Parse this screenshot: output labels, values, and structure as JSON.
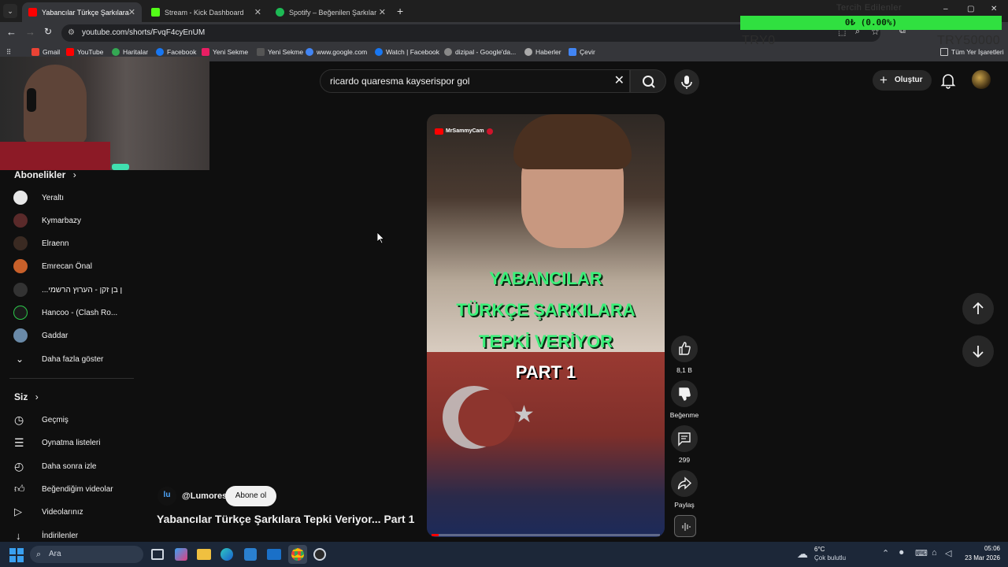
{
  "tabs": [
    {
      "label": "Yabancılar Türkçe Şarkılara Tepki",
      "color": "#ff0000"
    },
    {
      "label": "Stream - Kick Dashboard",
      "color": "#53fc18"
    },
    {
      "label": "Spotify – Beğenilen Şarkılar",
      "color": "#1db954"
    }
  ],
  "address": "youtube.com/shorts/FvqF4cyEnUM",
  "bookmarks": [
    "Gmail",
    "YouTube",
    "Haritalar",
    "Facebook",
    "Yeni Sekme",
    "Yeni Sekme",
    "www.google.com",
    "Watch | Facebook",
    "dizipal - Google'da...",
    "Haberler",
    "Çevir",
    "Tüm Yer İşaretleri"
  ],
  "search": {
    "query": "ricardo quaresma kayserispor gol"
  },
  "header": {
    "create_label": "Oluştur"
  },
  "sidebar": {
    "subs_title": "Abonelikler",
    "subs": [
      {
        "label": "Yeraltı",
        "color": "#e8e8e8"
      },
      {
        "label": "Kymarbazy",
        "color": "#5a2a2a"
      },
      {
        "label": "Elraenn",
        "color": "#3a2a22"
      },
      {
        "label": "Emrecan Önal",
        "color": "#c8602a"
      },
      {
        "label": "...ן בן זקן - הערוץ הרשמי",
        "color": "#333"
      },
      {
        "label": "Hancoo - (Clash Ro...",
        "color": "#1a1a1a"
      },
      {
        "label": "Gaddar",
        "color": "#6a8aa8"
      }
    ],
    "more_label": "Daha fazla göster",
    "you_title": "Siz",
    "you_items": [
      "Geçmiş",
      "Oynatma listeleri",
      "Daha sonra izle",
      "Beğendiğim videolar",
      "Videolarınız",
      "İndirilenler"
    ]
  },
  "short": {
    "watermark": "MrSammyCam",
    "overlay_lines": [
      "YABANCILAR",
      "TÜRKÇE ŞARKILARA",
      "TEPKİ VERİYOR",
      "PART 1"
    ],
    "channel": "@Lumores",
    "subscribe_label": "Abone ol",
    "title": "Yabancılar Türkçe Şarkılara Tepki Veriyor... Part 1",
    "likes": "8,1 B",
    "dislike_label": "Beğenme",
    "comments": "299",
    "share_label": "Paylaş",
    "progress": 0.03
  },
  "stream_overlay": {
    "bar_text": "0₺ (0.00%)",
    "left_text": "TRY0",
    "right_text": "TRY50000",
    "faint_text": "Tercih Edilenler"
  },
  "taskbar": {
    "search_placeholder": "Ara",
    "weather_temp": "6°C",
    "weather_desc": "Çok bulutlu",
    "time": "05:06",
    "date": "23 Mar 2026"
  }
}
